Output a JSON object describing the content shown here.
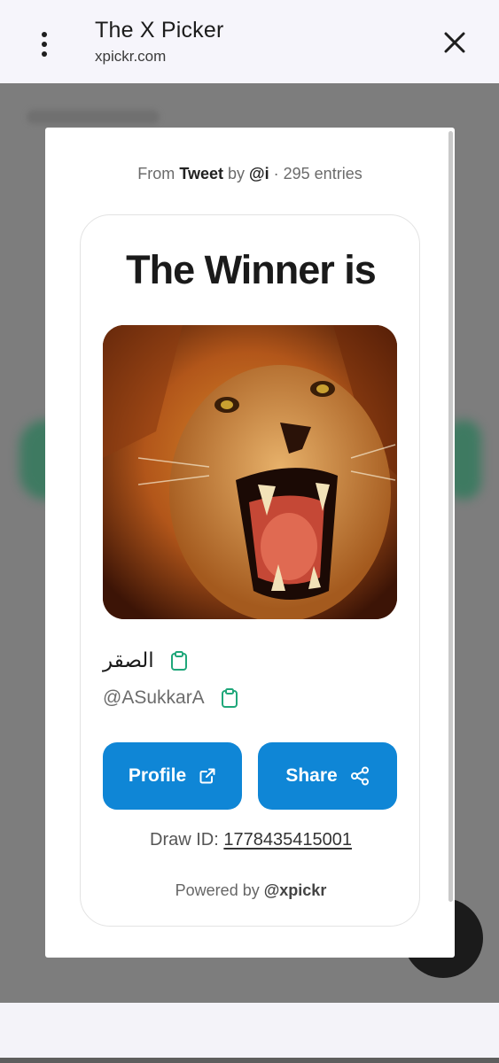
{
  "browser": {
    "title": "The X Picker",
    "url": "xpickr.com",
    "menu_icon": "more-vert-icon",
    "close_icon": "close-icon"
  },
  "modal": {
    "source": {
      "prefix": "From",
      "source_type": "Tweet",
      "by": "by",
      "author": "@i",
      "separator": "·",
      "entries": "295 entries"
    },
    "card": {
      "title": "The Winner is",
      "winner_name": "الصقر",
      "winner_handle": "@ASukkarA",
      "profile_button": "Profile",
      "share_button": "Share",
      "draw_label": "Draw ID:",
      "draw_id": "1778435415001",
      "powered_prefix": "Powered by",
      "powered_brand": "@xpickr"
    }
  },
  "colors": {
    "accent": "#0f86d6",
    "copy_icon": "#1fa77a",
    "overlay": "#7d7d7d"
  }
}
